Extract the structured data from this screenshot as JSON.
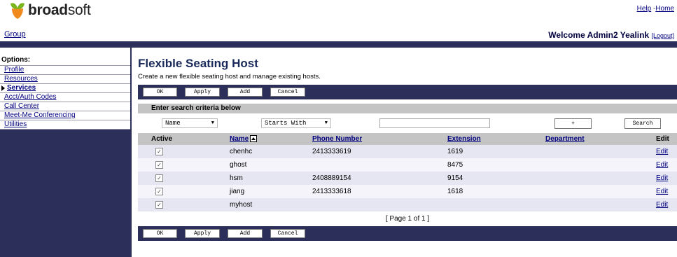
{
  "header": {
    "logo_text_bold": "broad",
    "logo_text_rest": "soft",
    "help_link": "Help",
    "separator": "-",
    "home_link": "Home",
    "group_link": "Group",
    "welcome_text": "Welcome Admin2 Yealink",
    "logout_link": "[Logout]"
  },
  "sidebar": {
    "title": "Options:",
    "items": [
      {
        "label": "Profile"
      },
      {
        "label": "Resources"
      },
      {
        "label": "Services",
        "active": true
      },
      {
        "label": "Acct/Auth Codes"
      },
      {
        "label": "Call Center"
      },
      {
        "label": "Meet-Me Conferencing"
      },
      {
        "label": "Utilities"
      }
    ]
  },
  "main": {
    "title": "Flexible Seating Host",
    "subtitle": "Create a new flexible seating host and manage existing hosts."
  },
  "buttons": {
    "ok": "OK",
    "apply": "Apply",
    "add": "Add",
    "cancel": "Cancel"
  },
  "search": {
    "header": "Enter search criteria below",
    "field_select": "Name",
    "mode_select": "Starts With",
    "input_value": "",
    "plus_button": "+",
    "search_button": "Search"
  },
  "table": {
    "columns": {
      "active": "Active",
      "name": "Name",
      "phone": "Phone Number",
      "extension": "Extension",
      "department": "Department",
      "edit": "Edit"
    },
    "rows": [
      {
        "checked": "✓",
        "name": "chenhc",
        "phone": "2413333619",
        "extension": "1619",
        "department": "",
        "edit": "Edit"
      },
      {
        "checked": "✓",
        "name": "ghost",
        "phone": "",
        "extension": "8475",
        "department": "",
        "edit": "Edit"
      },
      {
        "checked": "✓",
        "name": "hsm",
        "phone": "2408889154",
        "extension": "9154",
        "department": "",
        "edit": "Edit"
      },
      {
        "checked": "✓",
        "name": "jiang",
        "phone": "2413333618",
        "extension": "1618",
        "department": "",
        "edit": "Edit"
      },
      {
        "checked": "✓",
        "name": "myhost",
        "phone": "",
        "extension": "",
        "department": "",
        "edit": "Edit"
      }
    ],
    "pager": "[ Page 1 of 1 ]"
  },
  "colors": {
    "navy": "#2c2f59",
    "logo_orange": "#f08a1c",
    "logo_green": "#7ab51d",
    "link": "#000080"
  }
}
